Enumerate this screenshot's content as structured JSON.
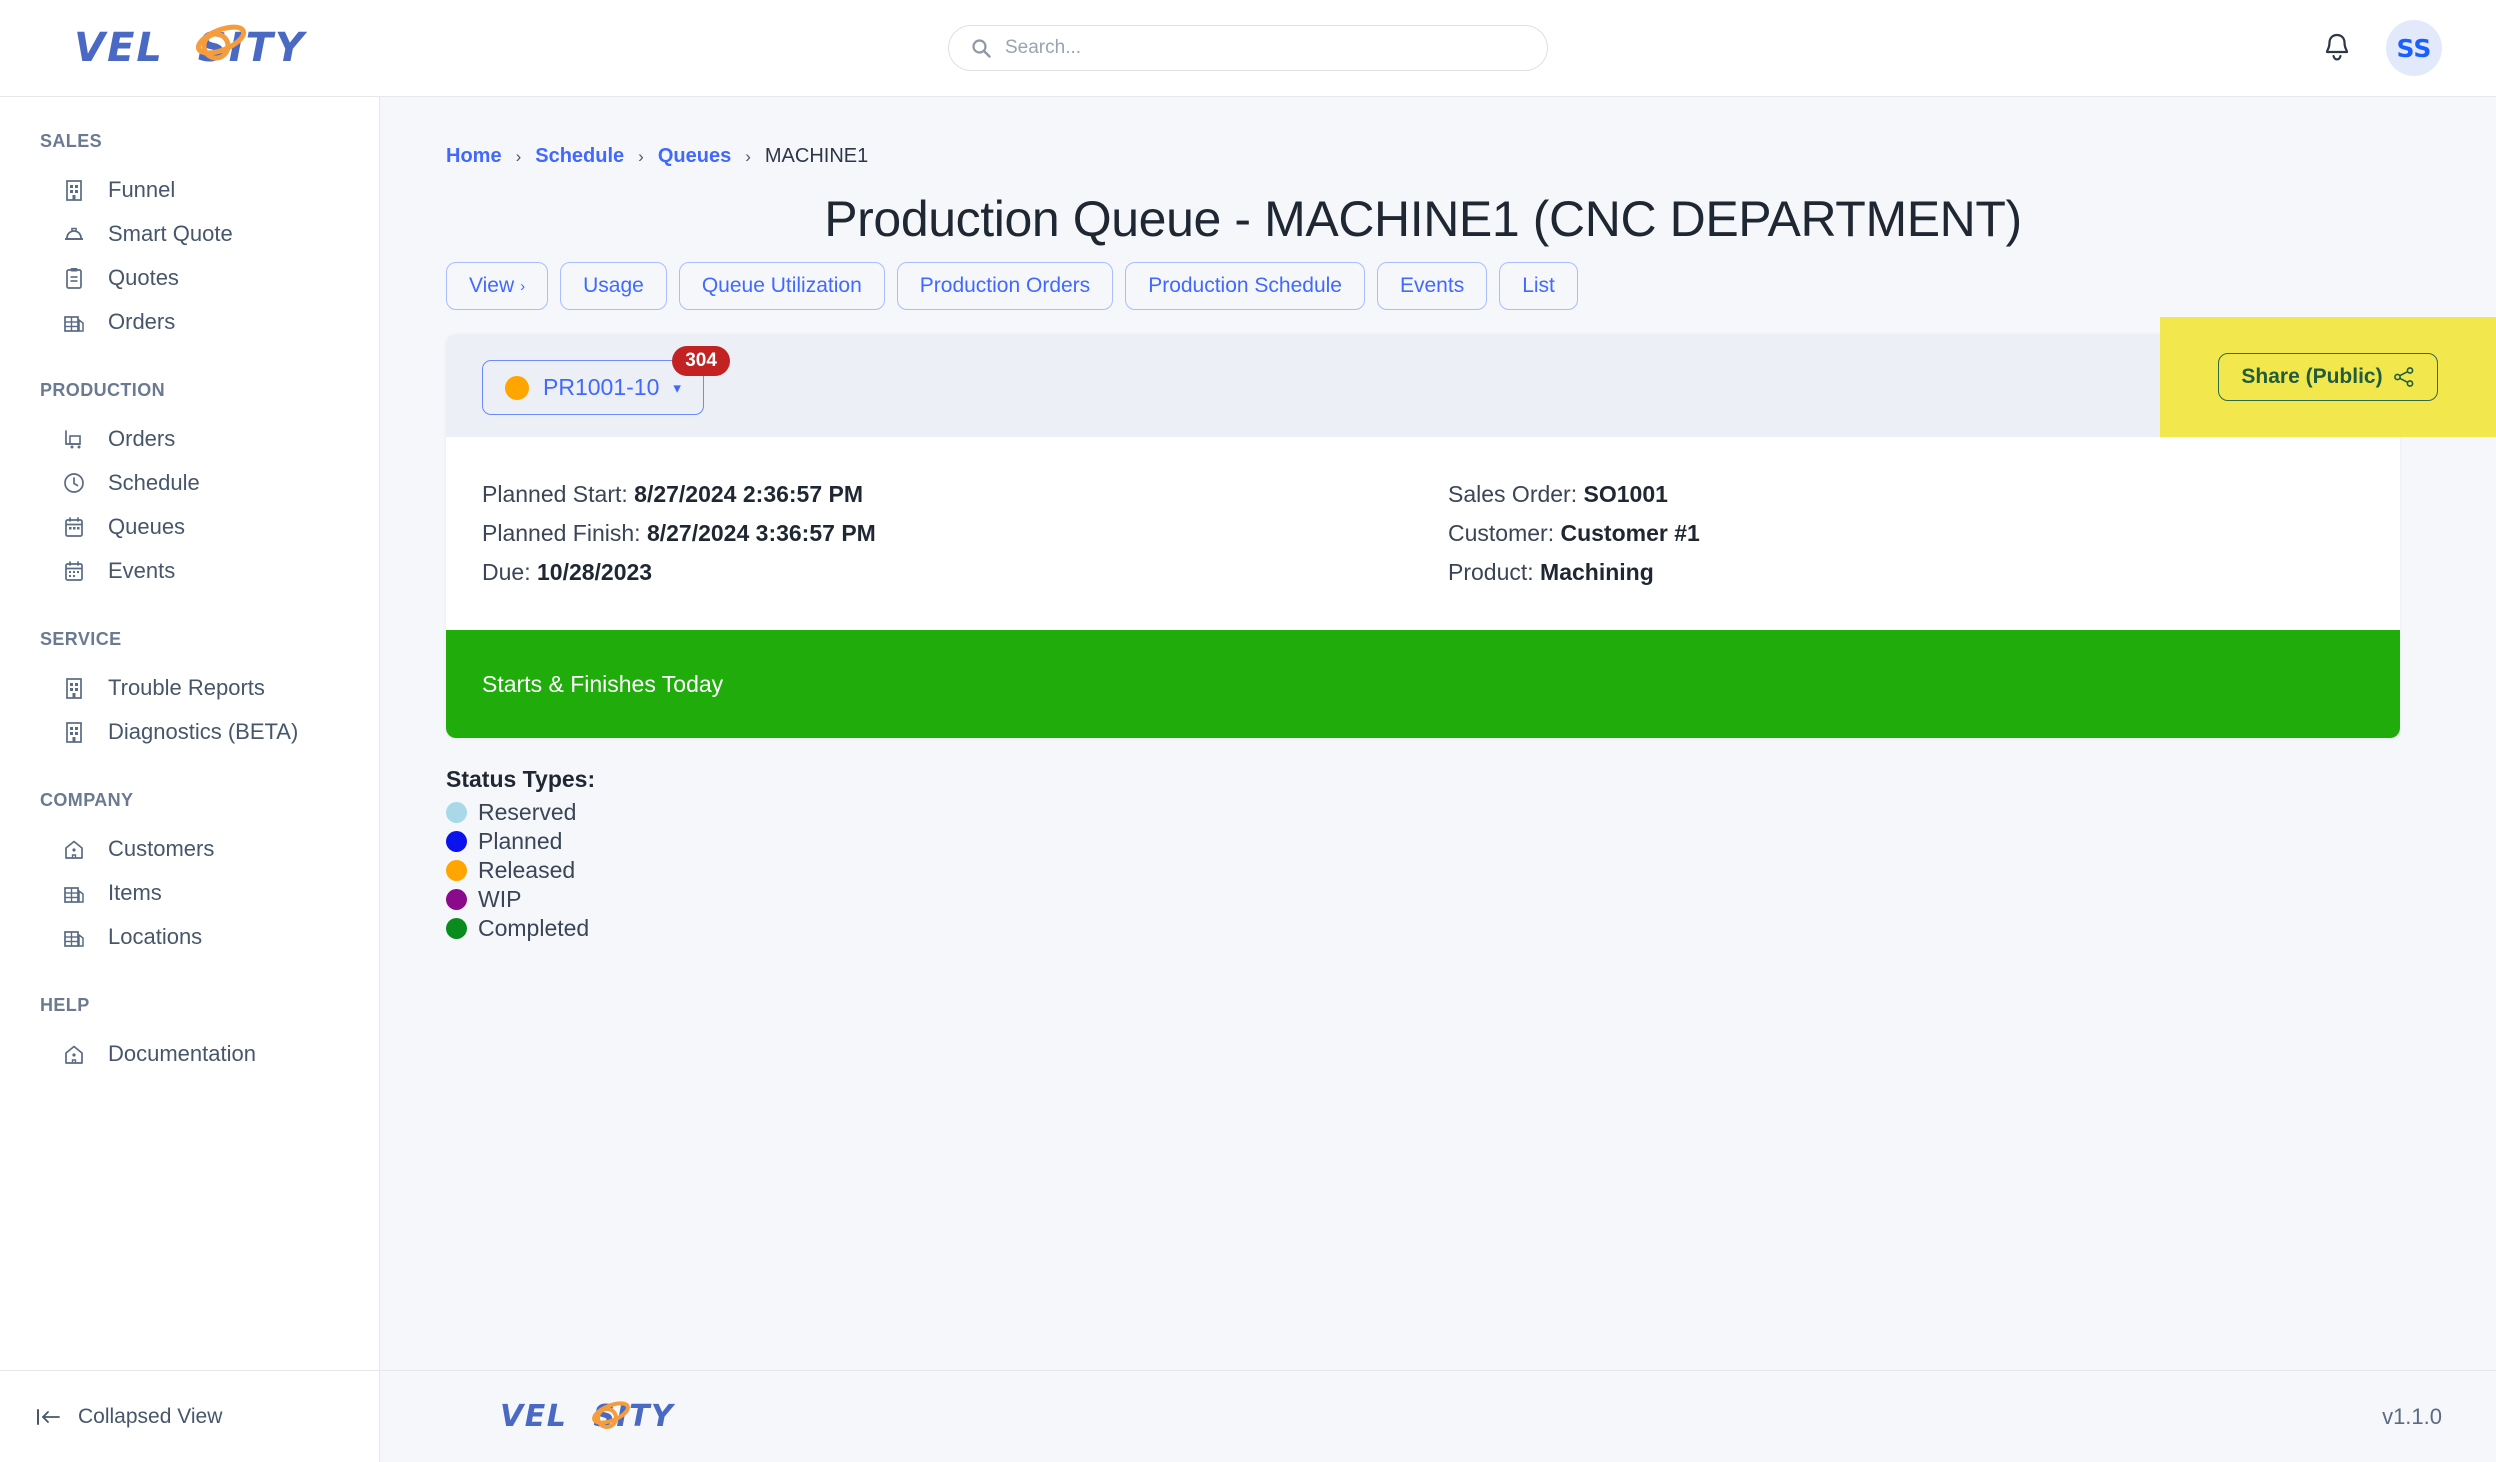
{
  "brand": {
    "name": "VELOSITY",
    "name_pre": "VEL",
    "name_post": "SITY",
    "color_text": "#4a69c4",
    "color_accent": "#f59c3c"
  },
  "header": {
    "search": {
      "placeholder": "Search...",
      "value": "",
      "icon": "search-icon"
    },
    "notifications_icon": "bell-icon",
    "avatar_initials": "SS"
  },
  "sidebar": {
    "groups": [
      {
        "label": "SALES",
        "items": [
          {
            "label": "Funnel",
            "icon": "building-icon"
          },
          {
            "label": "Smart Quote",
            "icon": "hardhat-icon"
          },
          {
            "label": "Quotes",
            "icon": "clipboard-icon"
          },
          {
            "label": "Orders",
            "icon": "warehouse-icon"
          }
        ]
      },
      {
        "label": "PRODUCTION",
        "items": [
          {
            "label": "Orders",
            "icon": "cart-icon"
          },
          {
            "label": "Schedule",
            "icon": "clock-icon"
          },
          {
            "label": "Queues",
            "icon": "calendar-icon"
          },
          {
            "label": "Events",
            "icon": "calendar-days-icon"
          }
        ]
      },
      {
        "label": "SERVICE",
        "items": [
          {
            "label": "Trouble Reports",
            "icon": "building-icon"
          },
          {
            "label": "Diagnostics (BETA)",
            "icon": "building-icon"
          }
        ]
      },
      {
        "label": "COMPANY",
        "items": [
          {
            "label": "Customers",
            "icon": "home-icon"
          },
          {
            "label": "Items",
            "icon": "warehouse-icon"
          },
          {
            "label": "Locations",
            "icon": "warehouse-icon"
          }
        ]
      },
      {
        "label": "HELP",
        "items": [
          {
            "label": "Documentation",
            "icon": "home-icon"
          }
        ]
      }
    ],
    "collapse": {
      "label": "Collapsed View",
      "icon": "collapse-left-icon"
    }
  },
  "breadcrumb": {
    "items": [
      {
        "label": "Home",
        "link": true
      },
      {
        "label": "Schedule",
        "link": true
      },
      {
        "label": "Queues",
        "link": true
      },
      {
        "label": "MACHINE1",
        "link": false
      }
    ],
    "separator": "›"
  },
  "page": {
    "title": "Production Queue - MACHINE1 (CNC DEPARTMENT)",
    "tabs": [
      {
        "label": "View",
        "caret": "›"
      },
      {
        "label": "Usage"
      },
      {
        "label": "Queue Utilization"
      },
      {
        "label": "Production Orders"
      },
      {
        "label": "Production Schedule"
      },
      {
        "label": "Events"
      },
      {
        "label": "List"
      }
    ]
  },
  "share": {
    "label": "Share (Public)",
    "icon": "share-icon",
    "panel_color": "#f2e84e",
    "text_color": "#215c3e"
  },
  "queue_card": {
    "selector": {
      "label": "PR1001-10",
      "dot_color": "#ffa500",
      "caret": "▾",
      "badge": "304",
      "badge_color": "#c22222"
    },
    "left_details": [
      {
        "label": "Planned Start:",
        "value": "8/27/2024 2:36:57 PM"
      },
      {
        "label": "Planned Finish:",
        "value": "8/27/2024 3:36:57 PM"
      },
      {
        "label": "Due:",
        "value": "10/28/2023"
      }
    ],
    "right_details": [
      {
        "label": "Sales Order:",
        "value": "SO1001"
      },
      {
        "label": "Customer:",
        "value": "Customer #1"
      },
      {
        "label": "Product:",
        "value": "Machining"
      }
    ],
    "banner": {
      "text": "Starts & Finishes Today",
      "color": "#20ad0c"
    }
  },
  "legend": {
    "title": "Status Types:",
    "items": [
      {
        "label": "Reserved",
        "color": "#a9d8e8"
      },
      {
        "label": "Planned",
        "color": "#0a12ee"
      },
      {
        "label": "Released",
        "color": "#ffa500"
      },
      {
        "label": "WIP",
        "color": "#8b0a8b"
      },
      {
        "label": "Completed",
        "color": "#0a8b1e"
      }
    ]
  },
  "footer": {
    "version": "v1.1.0"
  }
}
